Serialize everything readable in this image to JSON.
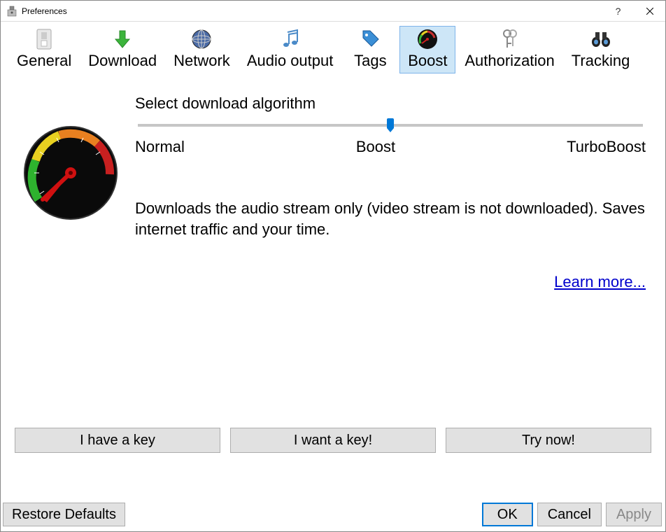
{
  "window": {
    "title": "Preferences"
  },
  "tabs": [
    {
      "label": "General"
    },
    {
      "label": "Download"
    },
    {
      "label": "Network"
    },
    {
      "label": "Audio output"
    },
    {
      "label": "Tags"
    },
    {
      "label": "Boost",
      "selected": true
    },
    {
      "label": "Authorization"
    },
    {
      "label": "Tracking"
    }
  ],
  "section": {
    "title": "Select download algorithm",
    "slider": {
      "labels": [
        "Normal",
        "Boost",
        "TurboBoost"
      ],
      "value_index": 1
    },
    "description": "Downloads the audio stream only (video stream is not downloaded). Saves internet traffic and your time.",
    "learn_more": "Learn more..."
  },
  "key_buttons": {
    "have": "I have a key",
    "want": "I want a key!",
    "try": "Try now!"
  },
  "footer": {
    "restore": "Restore Defaults",
    "ok": "OK",
    "cancel": "Cancel",
    "apply": "Apply"
  }
}
